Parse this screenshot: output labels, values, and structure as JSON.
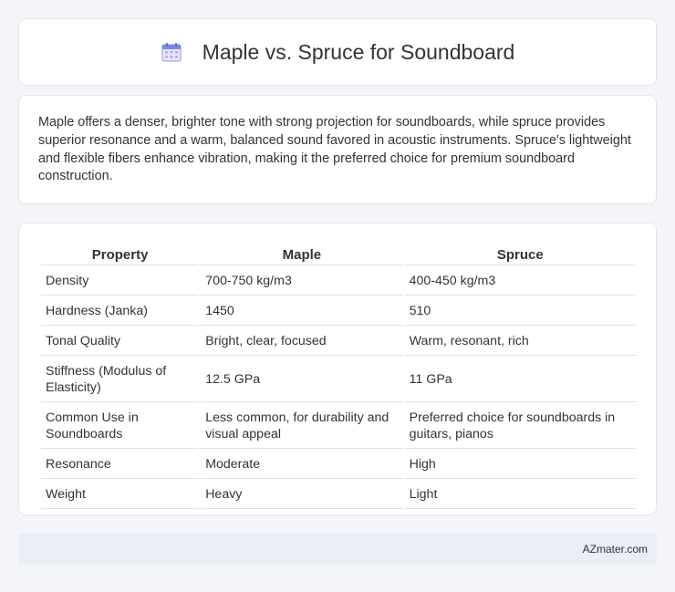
{
  "header": {
    "title": "Maple vs. Spruce for Soundboard",
    "icon": "calendar-icon"
  },
  "intro": {
    "text": "Maple offers a denser, brighter tone with strong projection for soundboards, while spruce provides superior resonance and a warm, balanced sound favored in acoustic instruments. Spruce's lightweight and flexible fibers enhance vibration, making it the preferred choice for premium soundboard construction."
  },
  "table": {
    "headers": [
      "Property",
      "Maple",
      "Spruce"
    ],
    "rows": [
      [
        "Density",
        "700-750 kg/m3",
        "400-450 kg/m3"
      ],
      [
        "Hardness (Janka)",
        "1450",
        "510"
      ],
      [
        "Tonal Quality",
        "Bright, clear, focused",
        "Warm, resonant, rich"
      ],
      [
        "Stiffness (Modulus of Elasticity)",
        "12.5 GPa",
        "11 GPa"
      ],
      [
        "Common Use in Soundboards",
        "Less common, for durability and visual appeal",
        "Preferred choice for soundboards in guitars, pianos"
      ],
      [
        "Resonance",
        "Moderate",
        "High"
      ],
      [
        "Weight",
        "Heavy",
        "Light"
      ]
    ]
  },
  "footer": {
    "brand": "AZmater.com"
  }
}
